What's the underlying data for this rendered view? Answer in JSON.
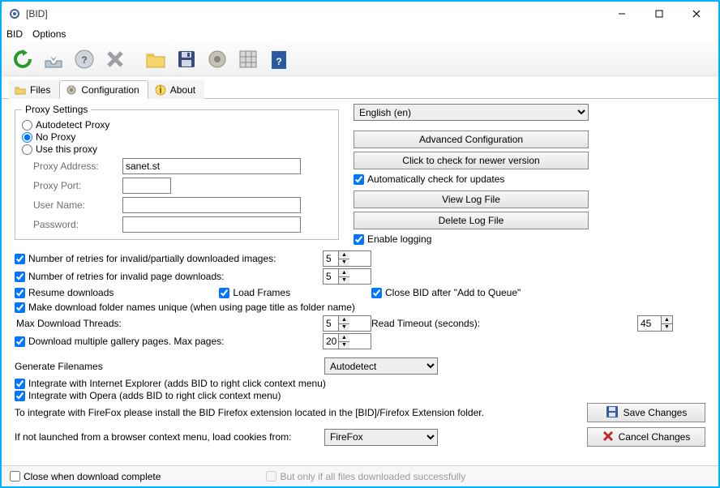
{
  "window": {
    "title": "[BID]"
  },
  "menu": {
    "bid": "BID",
    "options": "Options"
  },
  "tabs": {
    "files": "Files",
    "config": "Configuration",
    "about": "About"
  },
  "proxy": {
    "legend": "Proxy Settings",
    "autodetect": "Autodetect Proxy",
    "noproxy": "No Proxy",
    "usethis": "Use this proxy",
    "addr_label": "Proxy Address:",
    "addr_value": "sanet.st",
    "port_label": "Proxy Port:",
    "user_label": "User Name:",
    "pass_label": "Password:"
  },
  "lang": {
    "selected": "English (en)"
  },
  "buttons": {
    "adv": "Advanced Configuration",
    "check": "Click to check for newer version",
    "viewlog": "View Log File",
    "dellog": "Delete Log File",
    "save": "Save Changes",
    "cancel": "Cancel Changes"
  },
  "checks": {
    "autocheck": "Automatically check for updates",
    "enablelog": "Enable logging",
    "retries_img": "Number of retries for invalid/partially downloaded images:",
    "retries_page": "Number of retries for invalid page downloads:",
    "resume": "Resume downloads",
    "loadframes": "Load Frames",
    "closeafter": "Close BID after \"Add to Queue\"",
    "uniquefolders": "Make download folder names unique (when using page title as folder name)",
    "multipages": "Download multiple gallery pages. Max pages:",
    "ie": "Integrate with Internet Explorer (adds BID to right click context menu)",
    "opera": "Integrate with Opera (adds BID to right click context menu)",
    "closewhen": "Close when download complete",
    "onlyifall": "But only if all files downloaded successfully"
  },
  "labels": {
    "maxthreads": "Max Download Threads:",
    "readtimeout": "Read Timeout (seconds):",
    "genfilenames": "Generate Filenames",
    "firefoxnote": "To integrate with FireFox please install the BID Firefox extension located in the [BID]/Firefox Extension folder.",
    "cookienote": "If not launched from a browser context menu, load cookies from:"
  },
  "values": {
    "retries_img": "5",
    "retries_page": "5",
    "maxthreads": "5",
    "readtimeout": "45",
    "maxpages": "20",
    "genfilenames": "Autodetect",
    "cookies": "FireFox"
  },
  "icons": {
    "refresh": "refresh-icon",
    "open": "open-icon",
    "help": "help-icon",
    "cancelx": "cancel-icon",
    "folder": "folder-icon",
    "save": "save-icon",
    "gear": "gear-icon",
    "grid": "grid-icon",
    "question": "question-icon"
  }
}
